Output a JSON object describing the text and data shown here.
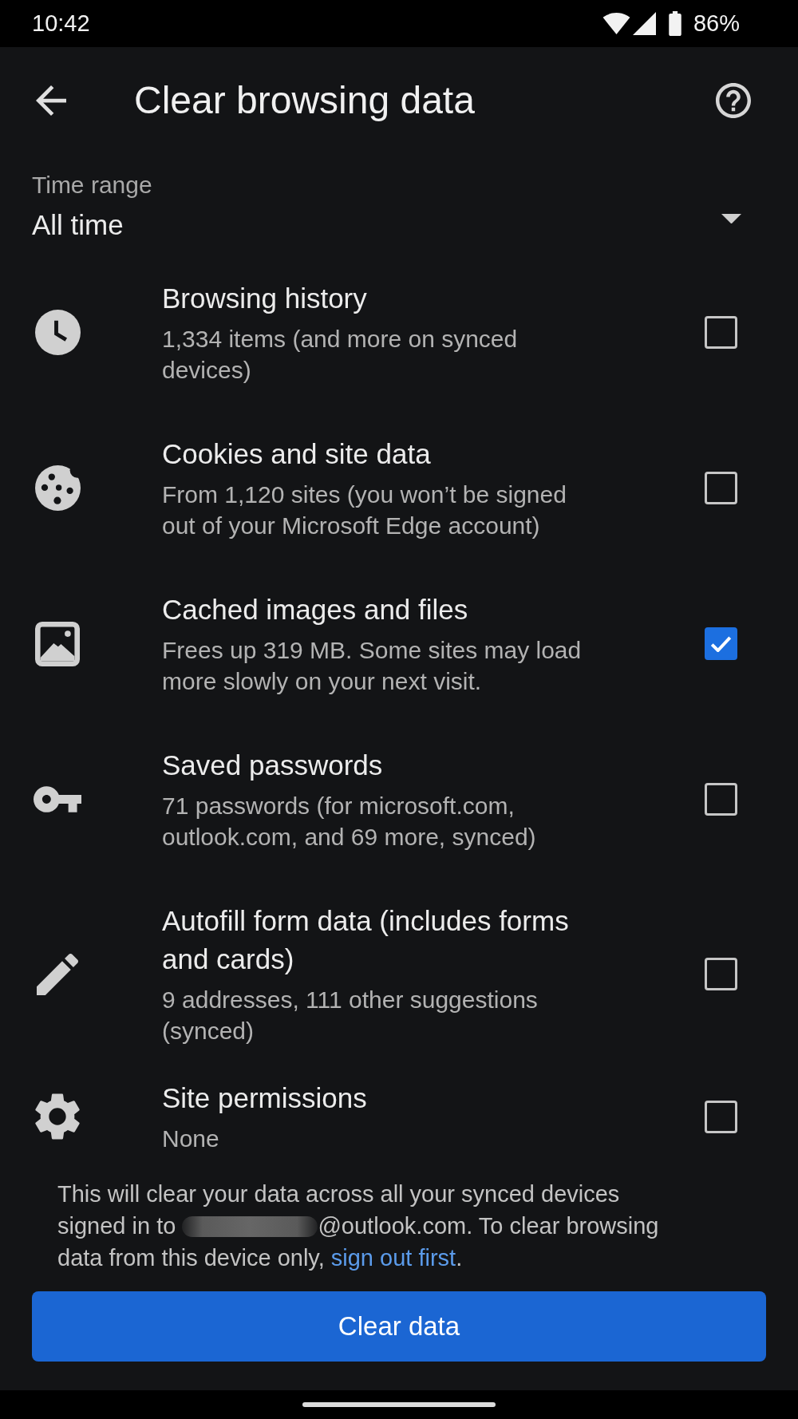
{
  "status_bar": {
    "time": "10:42",
    "battery": "86%"
  },
  "header": {
    "title": "Clear browsing data"
  },
  "time_range": {
    "label": "Time range",
    "value": "All time"
  },
  "items": [
    {
      "kind": "history",
      "title": "Browsing history",
      "subtitle": "1,334 items (and more on synced devices)",
      "checked": false
    },
    {
      "kind": "cookies",
      "title": "Cookies and site data",
      "subtitle": "From 1,120 sites (you won’t be signed out of your Microsoft Edge account)",
      "checked": false
    },
    {
      "kind": "cache",
      "title": "Cached images and files",
      "subtitle": "Frees up 319 MB. Some sites may load more slowly on your next visit.",
      "checked": true
    },
    {
      "kind": "passwords",
      "title": "Saved passwords",
      "subtitle": "71 passwords (for microsoft.com, outlook.com, and 69 more, synced)",
      "checked": false
    },
    {
      "kind": "autofill",
      "title": "Autofill form data (includes forms and cards)",
      "subtitle": "9 addresses, 111 other suggestions (synced)",
      "checked": false
    },
    {
      "kind": "permissions",
      "title": "Site permissions",
      "subtitle": "None",
      "checked": false
    }
  ],
  "note": {
    "text": "This will clear your data across all your synced devices signed in to",
    "email_redacted": true,
    "text_after": "@outlook.com. To clear browsing data from this device only,",
    "link": "sign out first",
    "end": "."
  },
  "button": {
    "label": "Clear data"
  }
}
